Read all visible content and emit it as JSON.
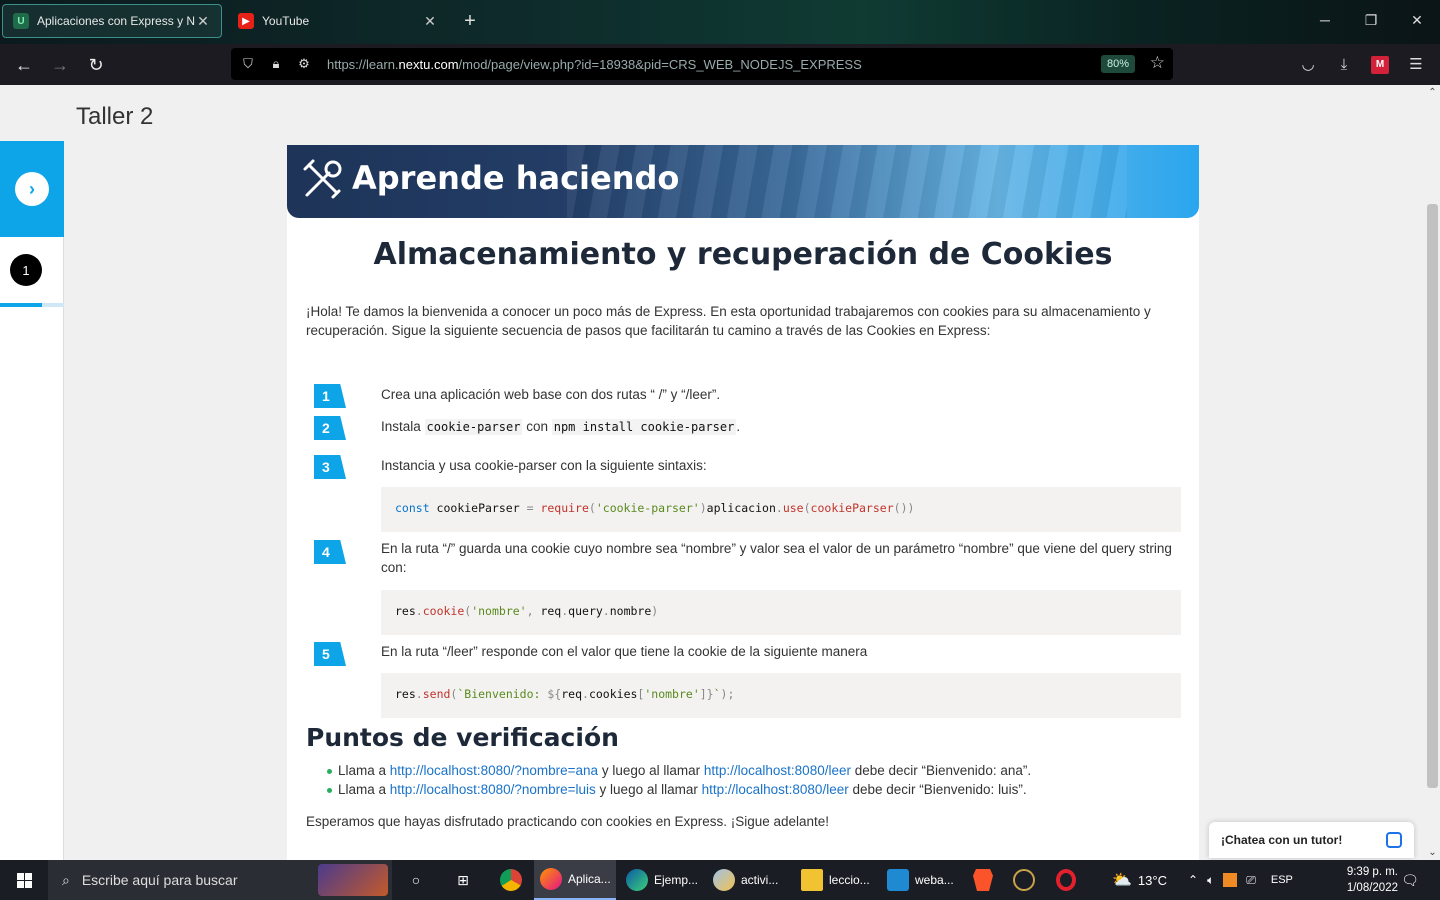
{
  "browser": {
    "tabs": [
      {
        "title": "Aplicaciones con Express y Nod",
        "favicon": "U",
        "active": true
      },
      {
        "title": "YouTube",
        "favicon": "youtube-icon",
        "active": false
      }
    ],
    "url_prefix": "https://learn.",
    "url_domain": "nextu.com",
    "url_path": "/mod/page/view.php?id=18938&pid=CRS_WEB_NODEJS_EXPRESS",
    "zoom": "80%"
  },
  "page": {
    "title": "Taller 2",
    "side_step": "1",
    "banner_title": "Aprende haciendo",
    "heading": "Almacenamiento y recuperación de Cookies",
    "intro": "¡Hola! Te damos la bienvenida a conocer un poco más de Express. En esta oportunidad trabajaremos con cookies para su almacenamiento y recuperación. Sigue la siguiente secuencia de pasos que facilitarán tu camino a través de las Cookies en Express:",
    "steps": [
      {
        "num": "1",
        "text": "Crea una aplicación web base con dos rutas “ /” y “/leer”."
      },
      {
        "num": "2",
        "text_a": "Instala ",
        "code_a": "cookie-parser",
        "text_b": " con ",
        "code_b": "npm install cookie-parser",
        "text_c": "."
      },
      {
        "num": "3",
        "text": "Instancia y usa cookie-parser con la siguiente sintaxis:"
      },
      {
        "num": "4",
        "text": "En la ruta “/” guarda una cookie cuyo nombre sea “nombre” y valor sea el valor de un parámetro “nombre” que viene del query string con:"
      },
      {
        "num": "5",
        "text": "En la ruta “/leer” responde con el valor que tiene la cookie de la siguiente manera"
      }
    ],
    "code": [
      "const cookieParser = require('cookie-parser')aplicacion.use(cookieParser())",
      "res.cookie('nombre', req.query.nombre)",
      "res.send(`Bienvenido: ${req.cookies['nombre']}`);"
    ],
    "checkpoints_title": "Puntos de verificación",
    "checkpoints": [
      {
        "pre": "Llama a ",
        "link1": "http://localhost:8080/?nombre=ana",
        "mid": " y luego al llamar ",
        "link2": "http://localhost:8080/leer",
        "post": " debe decir “Bienvenido: ana”."
      },
      {
        "pre": "Llama a ",
        "link1": "http://localhost:8080/?nombre=luis",
        "mid": " y luego al llamar ",
        "link2": "http://localhost:8080/leer",
        "post": " debe decir “Bienvenido: luis”."
      }
    ],
    "outro": "Esperamos que hayas disfrutado practicando con cookies en Express. ¡Sigue adelante!",
    "chat_label": "¡Chatea con un tutor!"
  },
  "taskbar": {
    "search_placeholder": "Escribe aquí para buscar",
    "apps": [
      "Aplica...",
      "Ejemp...",
      "activi...",
      "leccio...",
      "weba..."
    ],
    "temperature": "13°C",
    "language": "ESP",
    "time": "9:39 p. m.",
    "date": "1/08/2022"
  },
  "colors": {
    "accent": "#0da5e8",
    "heading": "#1d2838",
    "link": "#1a73c9"
  }
}
